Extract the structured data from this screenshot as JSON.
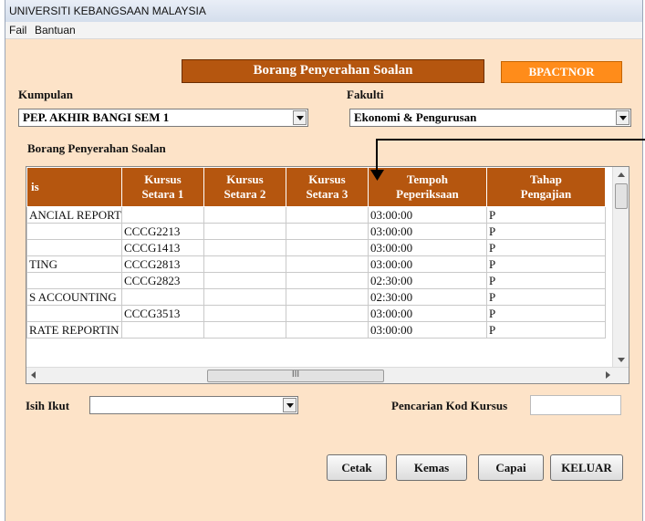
{
  "window": {
    "title": "UNIVERSITI KEBANGSAAN MALAYSIA"
  },
  "menu": {
    "items": [
      "Fail",
      "Bantuan"
    ]
  },
  "header": {
    "title": "Borang Penyerahan Soalan",
    "badge": "BPACTNOR"
  },
  "kumpulan": {
    "label": "Kumpulan",
    "value": "PEP. AKHIR BANGI SEM 1"
  },
  "fakulti": {
    "label": "Fakulti",
    "value": "Ekonomi & Pengurusan"
  },
  "grid": {
    "caption": "Borang Penyerahan Soalan",
    "columns": [
      "is",
      "Kursus\nSetara 1",
      "Kursus\nSetara 2",
      "Kursus\nSetara 3",
      "Tempoh\nPeperiksaan",
      "Tahap\nPengajian"
    ],
    "rows": [
      [
        "ANCIAL REPORT",
        "",
        "",
        "",
        "03:00:00",
        "P"
      ],
      [
        "",
        "CCCG2213",
        "",
        "",
        "03:00:00",
        "P"
      ],
      [
        "",
        "CCCG1413",
        "",
        "",
        "03:00:00",
        "P"
      ],
      [
        "TING",
        "CCCG2813",
        "",
        "",
        "03:00:00",
        "P"
      ],
      [
        "",
        "CCCG2823",
        "",
        "",
        "02:30:00",
        "P"
      ],
      [
        "S ACCOUNTING",
        "",
        "",
        "",
        "02:30:00",
        "P"
      ],
      [
        "",
        "CCCG3513",
        "",
        "",
        "03:00:00",
        "P"
      ],
      [
        "RATE REPORTIN",
        "",
        "",
        "",
        "03:00:00",
        "P"
      ]
    ],
    "hscroll_mark": "III"
  },
  "isih": {
    "label": "Isih Ikut",
    "value": ""
  },
  "search": {
    "label": "Pencarian Kod Kursus",
    "value": ""
  },
  "buttons": {
    "print": "Cetak",
    "update": "Kemas",
    "fetch": "Capai",
    "exit": "KELUAR"
  },
  "colors": {
    "background": "#fde3c8",
    "header": "#b5560f",
    "badge": "#ff8c1a"
  }
}
